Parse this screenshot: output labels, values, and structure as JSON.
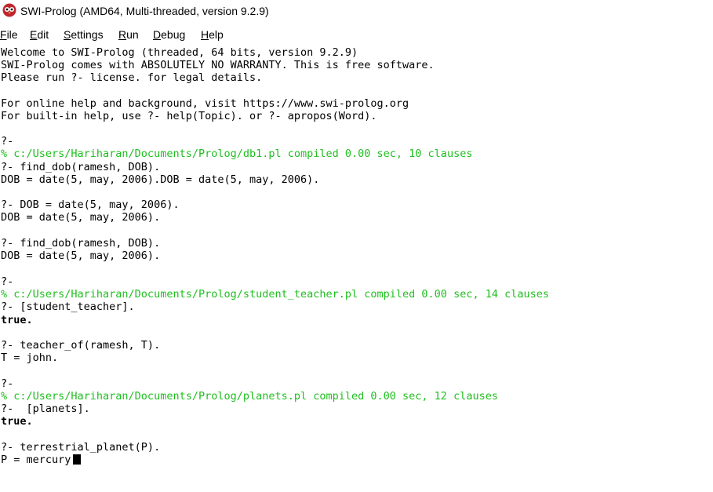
{
  "window": {
    "title": "SWI-Prolog (AMD64, Multi-threaded, version 9.2.9)",
    "icon": "swi-prolog-owl-icon"
  },
  "menu": [
    {
      "accel": "F",
      "rest": "ile"
    },
    {
      "accel": "E",
      "rest": "dit"
    },
    {
      "accel": "S",
      "rest": "ettings"
    },
    {
      "accel": "R",
      "rest": "un"
    },
    {
      "accel": "D",
      "rest": "ebug"
    },
    {
      "accel": "H",
      "rest": "elp"
    }
  ],
  "console": {
    "colors": {
      "output": "#000000",
      "load_message": "#1fbf1f"
    },
    "lines": [
      "Welcome to SWI-Prolog (threaded, 64 bits, version 9.2.9)",
      "SWI-Prolog comes with ABSOLUTELY NO WARRANTY. This is free software.",
      "Please run ?- license. for legal details.",
      "For online help and background, visit https://www.swi-prolog.org",
      "For built-in help, use ?- help(Topic). or ?- apropos(Word).",
      "?-",
      "% c:/Users/Hariharan/Documents/Prolog/db1.pl compiled 0.00 sec, 10 clauses",
      "?- find_dob(ramesh, DOB).",
      "DOB = date(5, may, 2006).DOB = date(5, may, 2006).",
      "?- DOB = date(5, may, 2006).",
      "DOB = date(5, may, 2006).",
      "?- find_dob(ramesh, DOB).",
      "DOB = date(5, may, 2006).",
      "?-",
      "% c:/Users/Hariharan/Documents/Prolog/student_teacher.pl compiled 0.00 sec, 14 clauses",
      "?- [student_teacher].",
      "true.",
      "?- teacher_of(ramesh, T).",
      "T = john.",
      "?-",
      "% c:/Users/Hariharan/Documents/Prolog/planets.pl compiled 0.00 sec, 12 clauses",
      "?-  [planets].",
      "true.",
      "?- terrestrial_planet(P).",
      "P = mercury"
    ]
  }
}
